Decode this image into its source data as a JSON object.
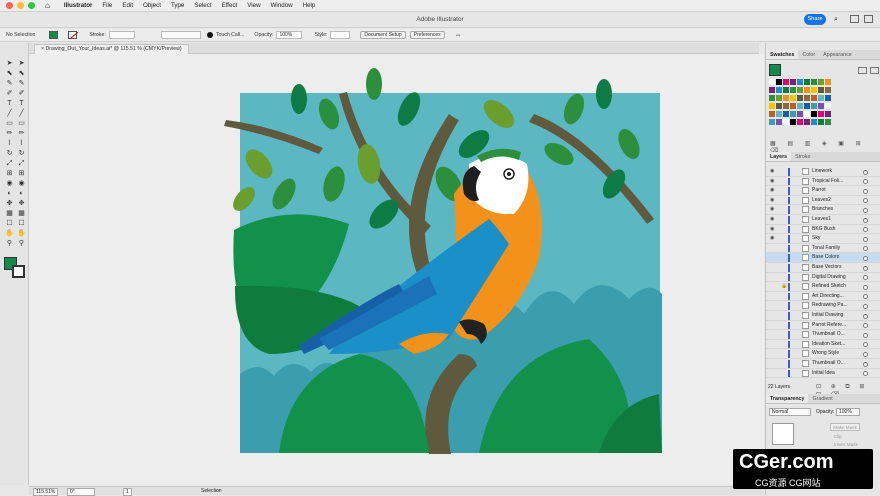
{
  "menubar": {
    "app": "Illustrator",
    "items": [
      "File",
      "Edit",
      "Object",
      "Type",
      "Select",
      "Effect",
      "View",
      "Window",
      "Help"
    ]
  },
  "titlebar": {
    "title": "Adobe Illustrator",
    "share": "Share"
  },
  "controlbar": {
    "selection": "No Selection",
    "stroke_label": "Stroke:",
    "brush": "Touch Call...",
    "opacity_label": "Opacity:",
    "opacity_value": "100%",
    "style_label": "Style:",
    "document_setup": "Document Setup",
    "preferences": "Preferences"
  },
  "document": {
    "tab": "Drawing_Out_Your_Ideas.ai* @ 115.51 % (CMYK/Preview)"
  },
  "status": {
    "zoom": "115.51%",
    "rotation": "0°",
    "artboard": "1",
    "tool": "Selection"
  },
  "swatches_panel": {
    "tabs": [
      "Swatches",
      "Color",
      "Appearance"
    ]
  },
  "layers_panel": {
    "tabs": [
      "Layers",
      "Stroke"
    ],
    "layers": [
      {
        "name": "Linework",
        "visible": true,
        "locked": false
      },
      {
        "name": "Tropical Foli...",
        "visible": true,
        "locked": false
      },
      {
        "name": "Parrot",
        "visible": true,
        "locked": false
      },
      {
        "name": "Leaves2",
        "visible": true,
        "locked": false
      },
      {
        "name": "Branches",
        "visible": true,
        "locked": false
      },
      {
        "name": "Leaves1",
        "visible": true,
        "locked": false
      },
      {
        "name": "BKG Bush",
        "visible": true,
        "locked": false
      },
      {
        "name": "Sky",
        "visible": true,
        "locked": false
      },
      {
        "name": "Tonal Family",
        "visible": false,
        "locked": false
      },
      {
        "name": "Base Colors",
        "visible": false,
        "locked": false,
        "selected": true
      },
      {
        "name": "Base Vectors",
        "visible": false,
        "locked": false
      },
      {
        "name": "Digital Drawing",
        "visible": false,
        "locked": false
      },
      {
        "name": "Refined Sketch",
        "visible": false,
        "locked": true
      },
      {
        "name": "Art Directing...",
        "visible": false,
        "locked": false
      },
      {
        "name": "Redrawing Pa...",
        "visible": false,
        "locked": false
      },
      {
        "name": "Initial Drawing",
        "visible": false,
        "locked": false
      },
      {
        "name": "Parrot Refere...",
        "visible": false,
        "locked": false
      },
      {
        "name": "Thumbnail O...",
        "visible": false,
        "locked": false
      },
      {
        "name": "Ideation Sket...",
        "visible": false,
        "locked": false
      },
      {
        "name": "Wrong Style",
        "visible": false,
        "locked": false
      },
      {
        "name": "Thumbnail O...",
        "visible": false,
        "locked": false
      },
      {
        "name": "Initial Idea",
        "visible": false,
        "locked": false
      }
    ],
    "count": "22 Layers"
  },
  "transparency_panel": {
    "tabs": [
      "Transparency",
      "Gradient"
    ],
    "blend_mode": "Normal",
    "opacity_label": "Opacity:",
    "opacity_value": "100%",
    "make_mask": "Make Mask",
    "clip": "Clip",
    "invert_mask": "Invert Mask"
  },
  "watermark": {
    "main": "CGer.com",
    "sub": "CG资源 CG网站"
  },
  "colors": {
    "sky": "#5bb8c2",
    "leaf_dark": "#0e7a44",
    "leaf_mid": "#2c8f3d",
    "leaf_light": "#6a9e2e",
    "branch": "#5f5a3e",
    "parrot_blue": "#1b8fc7",
    "parrot_orange": "#f2921a",
    "selected_layer": "#c7dcf3",
    "accent": "#1473e6"
  }
}
